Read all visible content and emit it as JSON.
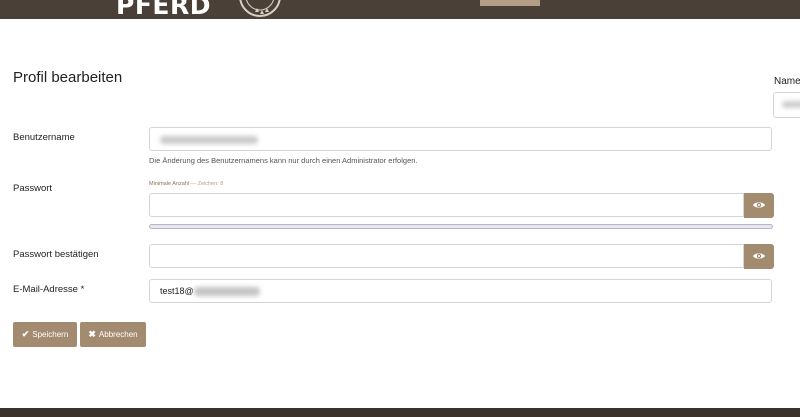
{
  "header": {
    "logo_text": "PFERD",
    "seal_icon": "badge-seal-icon",
    "bar_color": "#4b4037"
  },
  "page": {
    "title": "Profil bearbeiten"
  },
  "side": {
    "name_label": "Name"
  },
  "form": {
    "username": {
      "label": "Benutzername",
      "help": "Die Änderung des Benutzernamens kann nur durch einen Administrator erfolgen."
    },
    "password": {
      "label": "Passwort",
      "hint_label": "Minimale Anzahl",
      "hint_sub": " — Zeichen: 8",
      "eye_icon": "eye-icon",
      "strength": 0
    },
    "password_confirm": {
      "label": "Passwort bestätigen",
      "eye_icon": "eye-icon"
    },
    "email": {
      "label": "E-Mail-Adresse *",
      "value_visible": "test18@"
    }
  },
  "actions": {
    "save_label": "Speichern",
    "save_icon": "check-icon",
    "cancel_label": "Abbrechen",
    "cancel_icon": "x-icon"
  },
  "colors": {
    "accent": "#a38b6f",
    "footer": "#3a322b"
  }
}
